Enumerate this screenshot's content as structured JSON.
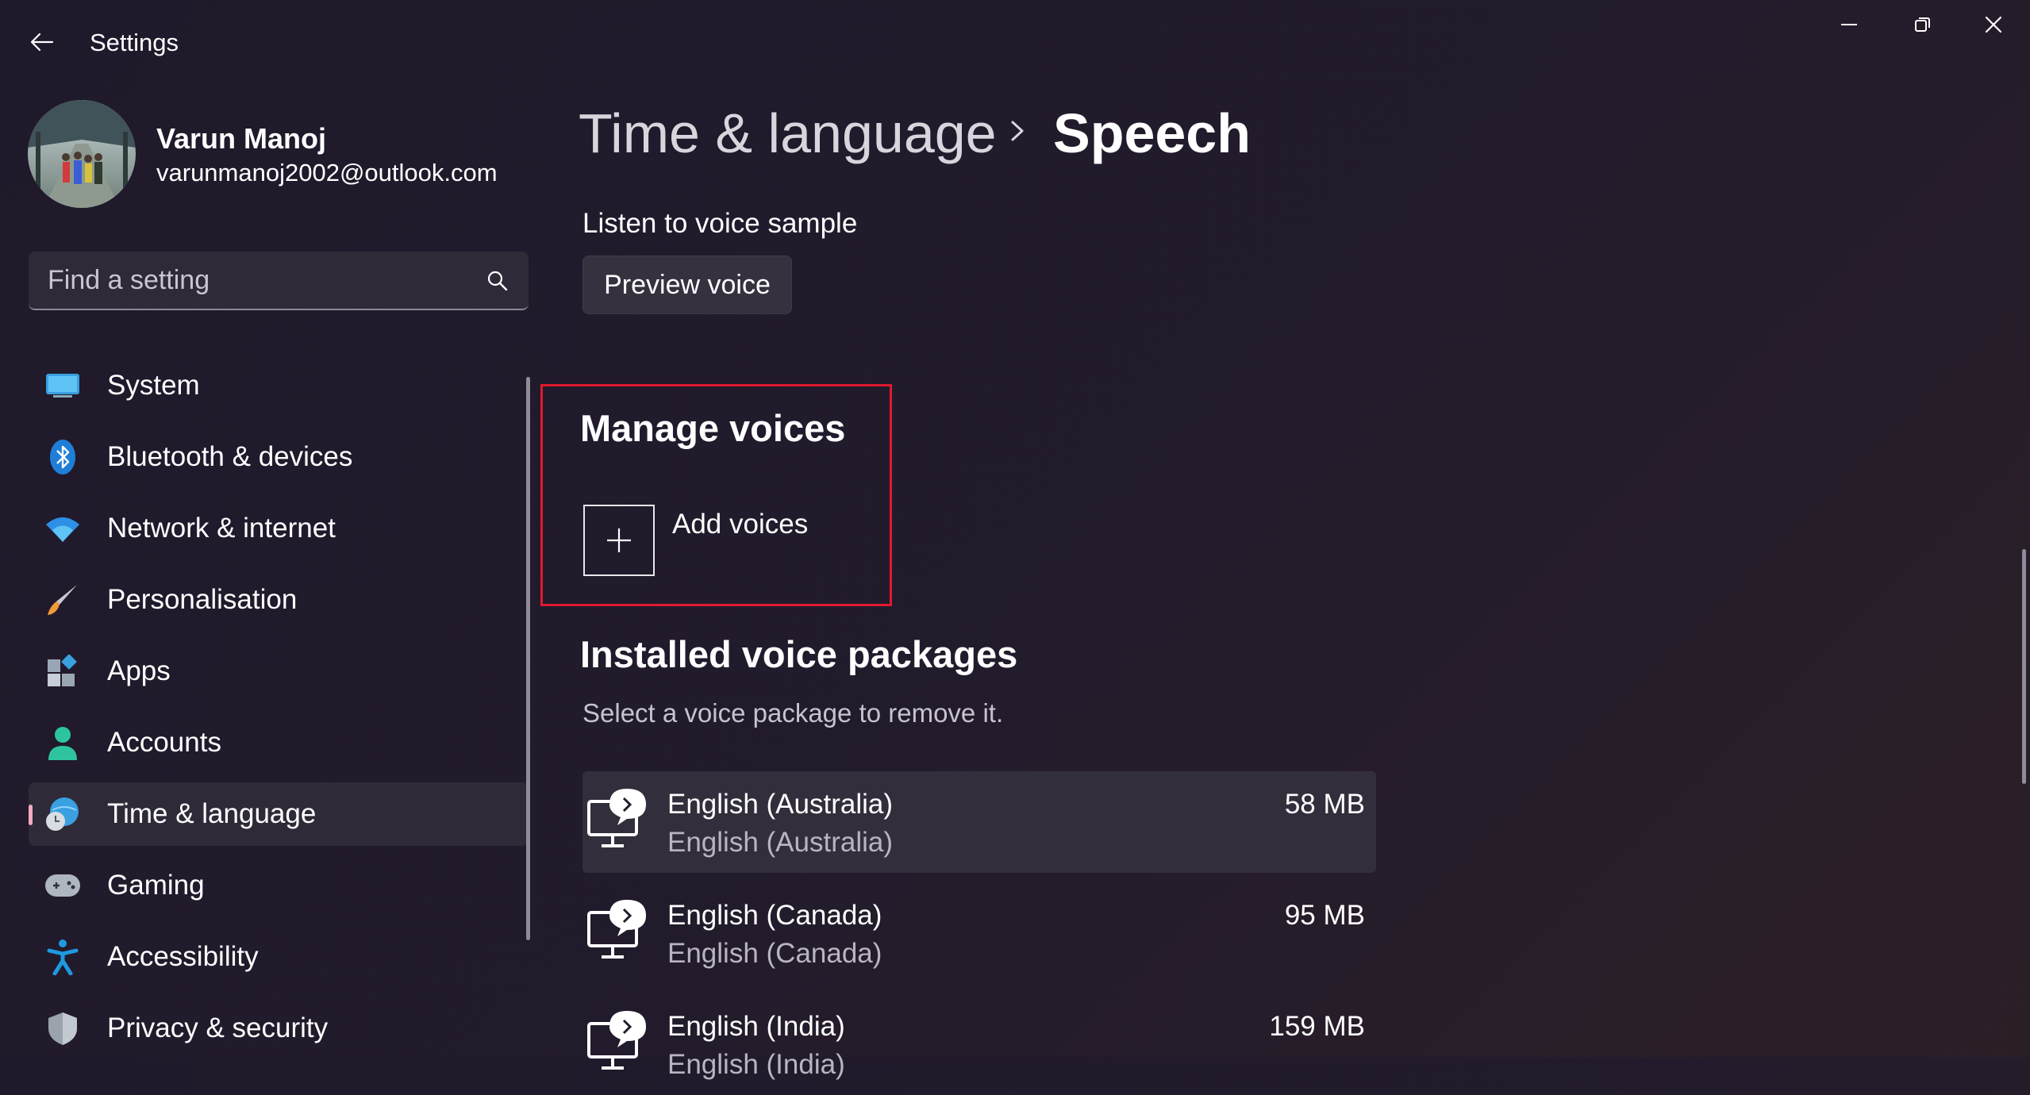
{
  "window": {
    "title": "Settings",
    "controls": [
      "minimize",
      "restore",
      "close"
    ]
  },
  "profile": {
    "name": "Varun Manoj",
    "email": "varunmanoj2002@outlook.com"
  },
  "search": {
    "placeholder": "Find a setting"
  },
  "sidebar": {
    "items": [
      {
        "label": "System",
        "icon": "system-icon",
        "active": false
      },
      {
        "label": "Bluetooth & devices",
        "icon": "bluetooth-icon",
        "active": false
      },
      {
        "label": "Network & internet",
        "icon": "wifi-icon",
        "active": false
      },
      {
        "label": "Personalisation",
        "icon": "brush-icon",
        "active": false
      },
      {
        "label": "Apps",
        "icon": "apps-icon",
        "active": false
      },
      {
        "label": "Accounts",
        "icon": "person-icon",
        "active": false
      },
      {
        "label": "Time & language",
        "icon": "globe-clock-icon",
        "active": true
      },
      {
        "label": "Gaming",
        "icon": "gamepad-icon",
        "active": false
      },
      {
        "label": "Accessibility",
        "icon": "accessibility-icon",
        "active": false
      },
      {
        "label": "Privacy & security",
        "icon": "shield-icon",
        "active": false
      }
    ]
  },
  "header": {
    "parent": "Time & language",
    "current": "Speech"
  },
  "main": {
    "listen_label": "Listen to voice sample",
    "preview_button": "Preview voice",
    "manage_title": "Manage voices",
    "add_voices_label": "Add voices",
    "installed_title": "Installed voice packages",
    "installed_desc": "Select a voice package to remove it.",
    "packages": [
      {
        "name": "English (Australia)",
        "sub": "English (Australia)",
        "size": "58 MB",
        "selected": true
      },
      {
        "name": "English (Canada)",
        "sub": "English (Canada)",
        "size": "95 MB",
        "selected": false
      },
      {
        "name": "English (India)",
        "sub": "English (India)",
        "size": "159 MB",
        "selected": false
      }
    ]
  },
  "colors": {
    "highlight": "#e0192d",
    "active_indicator": "#f4a9c0",
    "accent_blue": "#4cc2ff"
  }
}
